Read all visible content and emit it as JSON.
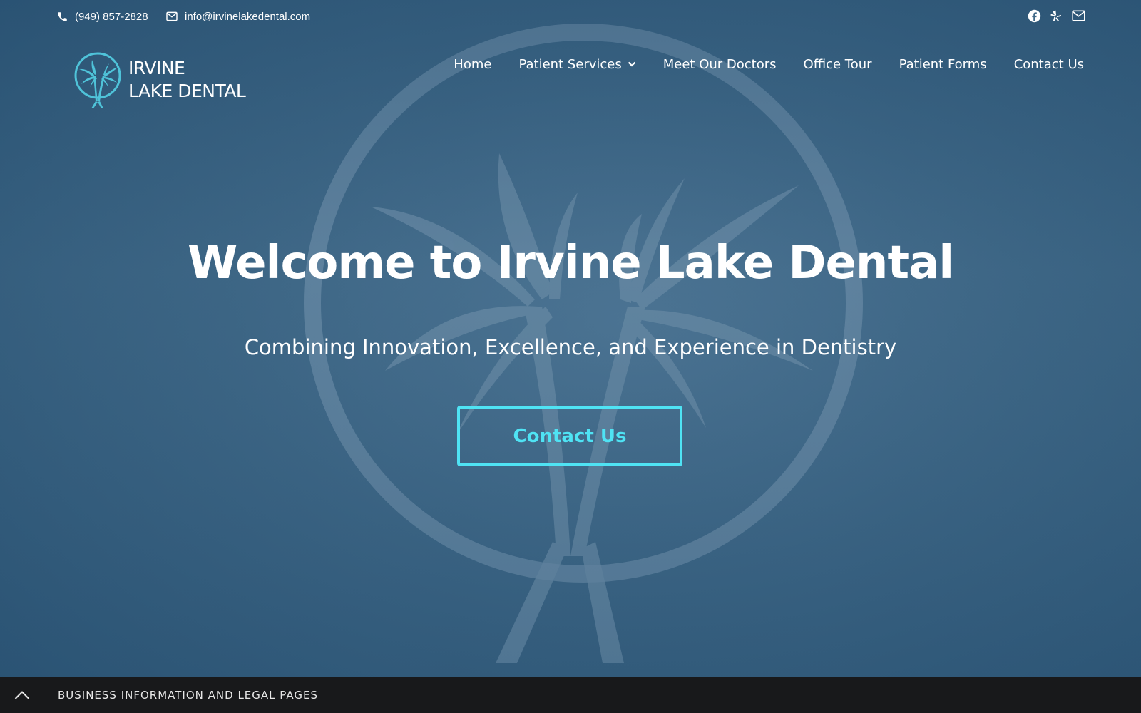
{
  "topbar": {
    "phone": "(949) 857-2828",
    "email": "info@irvinelakedental.com",
    "social_icons": [
      "facebook-icon",
      "yelp-icon",
      "mail-icon"
    ]
  },
  "logo": {
    "line1": "IRVINE",
    "line2": "LAKE DENTAL",
    "accent_color": "#4fc3d9"
  },
  "nav": {
    "items": [
      {
        "label": "Home"
      },
      {
        "label": "Patient Services",
        "has_dropdown": true
      },
      {
        "label": "Meet Our Doctors"
      },
      {
        "label": "Office Tour"
      },
      {
        "label": "Patient Forms"
      },
      {
        "label": "Contact Us"
      }
    ]
  },
  "hero": {
    "title": "Welcome to Irvine Lake Dental",
    "subtitle": "Combining Innovation, Excellence, and Experience in Dentistry",
    "cta_label": "Contact Us",
    "cta_color": "#4fe3f4"
  },
  "footer": {
    "label": "BUSINESS INFORMATION AND LEGAL PAGES",
    "background": "#18191b"
  }
}
